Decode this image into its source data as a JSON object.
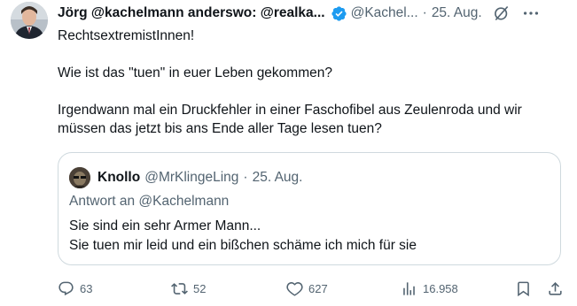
{
  "tweet": {
    "author_name": "Jörg @kachelmann anderswo: @realka...",
    "handle": "@Kachel...",
    "separator": "·",
    "date": "25. Aug.",
    "paragraphs": [
      "RechtsextremistInnen!",
      "Wie ist das \"tuen\" in euer Leben gekommen?",
      "Irgendwann mal ein Druckfehler in einer Faschofibel aus Zeulenroda und wir müssen das jetzt bis ans Ende aller Tage lesen tuen?"
    ]
  },
  "quote": {
    "author_name": "Knollo",
    "handle": "@MrKlingeLing",
    "separator": "·",
    "date": "25. Aug.",
    "reply_prefix": "Antwort an ",
    "reply_mention": "@Kachelmann",
    "lines": [
      "Sie sind ein sehr Armer Mann...",
      "Sie tuen mir leid und ein bißchen schäme ich mich für sie"
    ]
  },
  "actions": {
    "reply_count": "63",
    "retweet_count": "52",
    "like_count": "627",
    "views_count": "16.958"
  },
  "icons": {
    "verified": "verified-badge-icon",
    "grok": "grok-icon",
    "more": "more-icon",
    "reply": "reply-icon",
    "retweet": "retweet-icon",
    "like": "heart-icon",
    "views": "views-icon",
    "bookmark": "bookmark-icon",
    "share": "share-icon"
  },
  "colors": {
    "verified": "#1d9bf0",
    "text": "#0f1419",
    "muted": "#536471",
    "border": "#cfd9de"
  }
}
